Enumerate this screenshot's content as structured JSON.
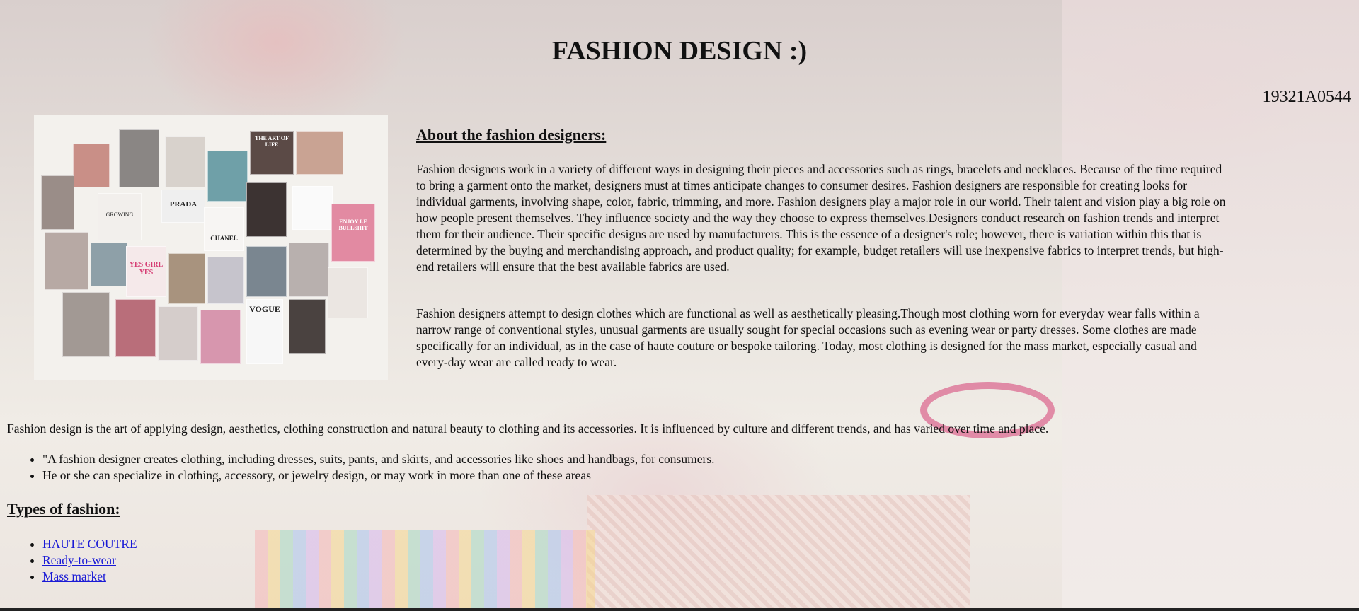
{
  "page": {
    "title": "FASHION DESIGN :)",
    "id_text": "19321A0544"
  },
  "collage": {
    "tile_texts": [
      "THE ART OF LIFE",
      "PRADA",
      "CHANEL",
      "VOGUE",
      "YES GIRL YES",
      "GROWING",
      "ENJOY LE BULLSHIT"
    ]
  },
  "about": {
    "heading": "About the fashion designers:",
    "paragraph1": "Fashion designers work in a variety of different ways in designing their pieces and accessories such as rings, bracelets and necklaces. Because of the time required to bring a garment onto the market, designers must at times anticipate changes to consumer desires. Fashion designers are responsible for creating looks for individual garments, involving shape, color, fabric, trimming, and more. Fashion designers play a major role in our world. Their talent and vision play a big role on how people present themselves. They influence society and the way they choose to express themselves.Designers conduct research on fashion trends and interpret them for their audience. Their specific designs are used by manufacturers. This is the essence of a designer's role; however, there is variation within this that is determined by the buying and merchandising approach, and product quality; for example, budget retailers will use inexpensive fabrics to interpret trends, but high-end retailers will ensure that the best available fabrics are used.",
    "paragraph2": "Fashion designers attempt to design clothes which are functional as well as aesthetically pleasing.Though most clothing worn for everyday wear falls within a narrow range of conventional styles, unusual garments are usually sought for special occasions such as evening wear or party dresses. Some clothes are made specifically for an individual, as in the case of haute couture or bespoke tailoring. Today, most clothing is designed for the mass market, especially casual and every-day wear are called ready to wear."
  },
  "intro": "Fashion design is the art of applying design, aesthetics, clothing construction and natural beauty to clothing and its accessories. It is influenced by culture and different trends, and has varied over time and place.",
  "bullets": [
    "\"A fashion designer creates clothing, including dresses, suits, pants, and skirts, and accessories like shoes and handbags, for consumers.",
    "He or she can specialize in clothing, accessory, or jewelry design, or may work in more than one of these areas"
  ],
  "types": {
    "heading": "Types of fashion:",
    "links": [
      "HAUTE COUTRE",
      "Ready-to-wear",
      "Mass market"
    ]
  },
  "colors": {
    "link": "#1a1ad6",
    "text": "#111111"
  }
}
